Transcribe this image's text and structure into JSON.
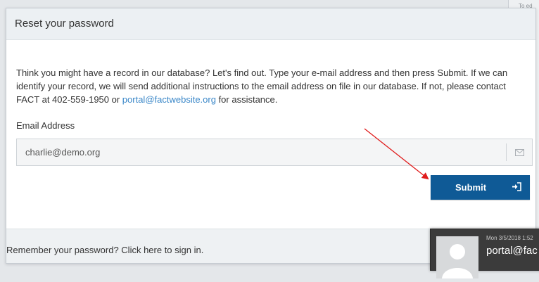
{
  "background": {
    "side_text": "To ed"
  },
  "modal": {
    "title": "Reset your password",
    "intro_before_link": "Think you might have a record in our database? Let's find out. Type your e-mail address and then press Submit. If we can identify your record, we will send additional instructions to the email address on file in our database. If not, please contact FACT at 402-559-1950 or ",
    "intro_link": "portal@factwebsite.org",
    "intro_after_link": " for assistance.",
    "email_label": "Email Address",
    "email_value": "charlie@demo.org",
    "email_icon": "envelope-icon",
    "submit_label": "Submit",
    "submit_icon": "sign-in-icon",
    "footer_text": "Remember your password? Click here to sign in."
  },
  "notification": {
    "date": "Mon 3/5/2018 1:52",
    "sender": "portal@fac"
  },
  "annotation": {
    "arrow_color": "#e01b1b"
  },
  "colors": {
    "primary_button": "#0f5a96",
    "link": "#3a87c8",
    "header_bg": "#ecf0f3"
  }
}
